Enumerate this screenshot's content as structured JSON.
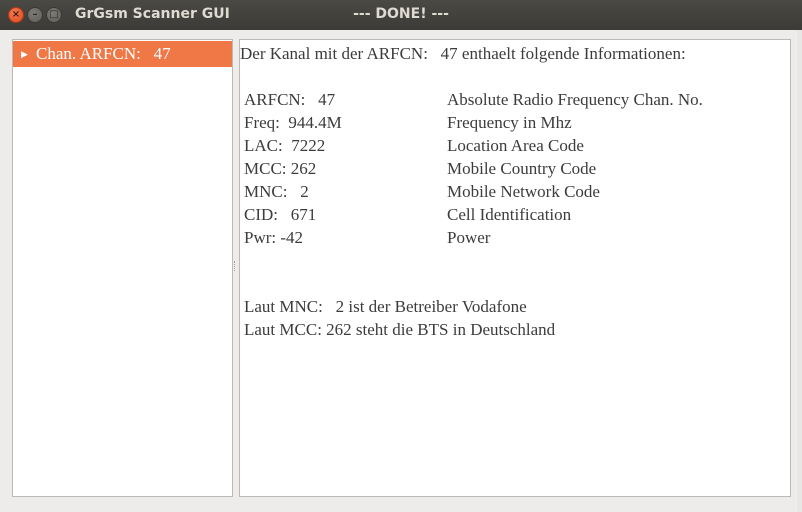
{
  "titlebar": {
    "app_title": "GrGsm Scanner GUI",
    "window_title": "--- DONE! ---",
    "close_icon": "×",
    "minimize_icon": "–",
    "maximize_icon": "□"
  },
  "tree": {
    "items": [
      {
        "label": "Chan. ARFCN:   47",
        "expanded": false,
        "selected": true
      }
    ]
  },
  "info": {
    "heading": "Der Kanal mit der ARFCN:   47 enthaelt folgende Informationen:",
    "rows": [
      {
        "value": "ARFCN:   47",
        "desc": "Absolute Radio Frequency Chan. No."
      },
      {
        "value": "Freq:  944.4M",
        "desc": "Frequency in Mhz"
      },
      {
        "value": "LAC:  7222",
        "desc": "Location Area Code"
      },
      {
        "value": "MCC: 262",
        "desc": "Mobile Country Code"
      },
      {
        "value": "MNC:   2",
        "desc": "Mobile Network Code"
      },
      {
        "value": "CID:   671",
        "desc": "Cell Identification"
      },
      {
        "value": "Pwr: -42",
        "desc": "Power"
      }
    ],
    "note_mnc": "Laut MNC:   2 ist der Betreiber Vodafone",
    "note_mcc": "Laut MCC: 262 steht die BTS in Deutschland"
  },
  "colors": {
    "selection": "#f07746",
    "titlebar": "#3c3b37",
    "close_button": "#e0461c"
  }
}
